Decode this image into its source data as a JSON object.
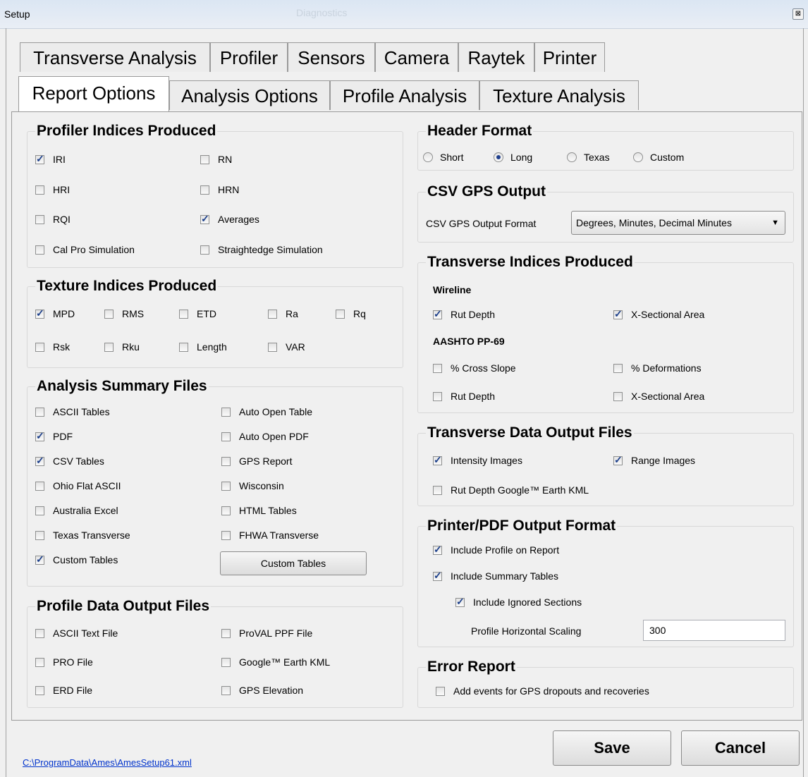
{
  "window": {
    "title": "Setup",
    "ghost_title": "Diagnostics",
    "close_symbol": "⊠"
  },
  "tabs_row1": [
    "Transverse Analysis",
    "Profiler",
    "Sensors",
    "Camera",
    "Raytek",
    "Printer"
  ],
  "tabs_row2": [
    "Report Options",
    "Analysis Options",
    "Profile Analysis",
    "Texture Analysis"
  ],
  "active_tab": "Report Options",
  "profiler_indices": {
    "title": "Profiler Indices Produced",
    "items": [
      {
        "label": "IRI",
        "checked": true
      },
      {
        "label": "RN",
        "checked": false
      },
      {
        "label": "HRI",
        "checked": false
      },
      {
        "label": "HRN",
        "checked": false
      },
      {
        "label": "RQI",
        "checked": false
      },
      {
        "label": "Averages",
        "checked": true
      },
      {
        "label": "Cal Pro Simulation",
        "checked": false
      },
      {
        "label": "Straightedge Simulation",
        "checked": false
      }
    ]
  },
  "texture_indices": {
    "title": "Texture Indices Produced",
    "items": [
      {
        "label": "MPD",
        "checked": true
      },
      {
        "label": "RMS",
        "checked": false
      },
      {
        "label": "ETD",
        "checked": false
      },
      {
        "label": "Ra",
        "checked": false
      },
      {
        "label": "Rq",
        "checked": false
      },
      {
        "label": "Rsk",
        "checked": false
      },
      {
        "label": "Rku",
        "checked": false
      },
      {
        "label": "Length",
        "checked": false
      },
      {
        "label": "VAR",
        "checked": false
      }
    ]
  },
  "analysis_summary": {
    "title": "Analysis Summary Files",
    "items": [
      {
        "label": "ASCII Tables",
        "checked": false
      },
      {
        "label": "Auto Open Table",
        "checked": false
      },
      {
        "label": "PDF",
        "checked": true
      },
      {
        "label": "Auto Open PDF",
        "checked": false
      },
      {
        "label": "CSV Tables",
        "checked": true
      },
      {
        "label": "GPS Report",
        "checked": false
      },
      {
        "label": "Ohio Flat ASCII",
        "checked": false
      },
      {
        "label": "Wisconsin",
        "checked": false
      },
      {
        "label": "Australia Excel",
        "checked": false
      },
      {
        "label": "HTML Tables",
        "checked": false
      },
      {
        "label": "Texas Transverse",
        "checked": false
      },
      {
        "label": "FHWA Transverse",
        "checked": false
      },
      {
        "label": "Custom Tables",
        "checked": true
      }
    ],
    "button_label": "Custom Tables"
  },
  "profile_output": {
    "title": "Profile Data Output Files",
    "items": [
      {
        "label": "ASCII Text File",
        "checked": false
      },
      {
        "label": "ProVAL PPF File",
        "checked": false
      },
      {
        "label": "PRO File",
        "checked": false
      },
      {
        "label": "Google™ Earth KML",
        "checked": false
      },
      {
        "label": "ERD File",
        "checked": false
      },
      {
        "label": "GPS Elevation",
        "checked": false
      }
    ]
  },
  "header_format": {
    "title": "Header Format",
    "options": [
      {
        "label": "Short",
        "selected": false
      },
      {
        "label": "Long",
        "selected": true
      },
      {
        "label": "Texas",
        "selected": false
      },
      {
        "label": "Custom",
        "selected": false
      }
    ]
  },
  "csv_gps": {
    "title": "CSV GPS Output",
    "label": "CSV GPS Output Format",
    "value": "Degrees, Minutes, Decimal Minutes"
  },
  "transverse_indices": {
    "title": "Transverse Indices Produced",
    "wireline_label": "Wireline",
    "aashto_label": "AASHTO PP-69",
    "wireline": [
      {
        "label": "Rut Depth",
        "checked": true
      },
      {
        "label": "X-Sectional Area",
        "checked": true
      }
    ],
    "aashto": [
      {
        "label": "% Cross Slope",
        "checked": false
      },
      {
        "label": "% Deformations",
        "checked": false
      },
      {
        "label": "Rut Depth",
        "checked": false
      },
      {
        "label": "X-Sectional Area",
        "checked": false
      }
    ]
  },
  "transverse_output": {
    "title": "Transverse Data Output Files",
    "items": [
      {
        "label": "Intensity Images",
        "checked": true
      },
      {
        "label": "Range Images",
        "checked": true
      },
      {
        "label": "Rut Depth Google™ Earth KML",
        "checked": false
      }
    ]
  },
  "printer_pdf": {
    "title": "Printer/PDF Output Format",
    "items": [
      {
        "label": "Include Profile on Report",
        "checked": true
      },
      {
        "label": "Include Summary Tables",
        "checked": true
      },
      {
        "label": "Include Ignored Sections",
        "checked": true
      }
    ],
    "scaling_label": "Profile Horizontal Scaling",
    "scaling_value": "300"
  },
  "error_report": {
    "title": "Error Report",
    "items": [
      {
        "label": "Add events for GPS dropouts and recoveries",
        "checked": false
      }
    ]
  },
  "footer": {
    "path": "C:\\ProgramData\\Ames\\AmesSetup61.xml",
    "save_label": "Save",
    "cancel_label": "Cancel"
  }
}
